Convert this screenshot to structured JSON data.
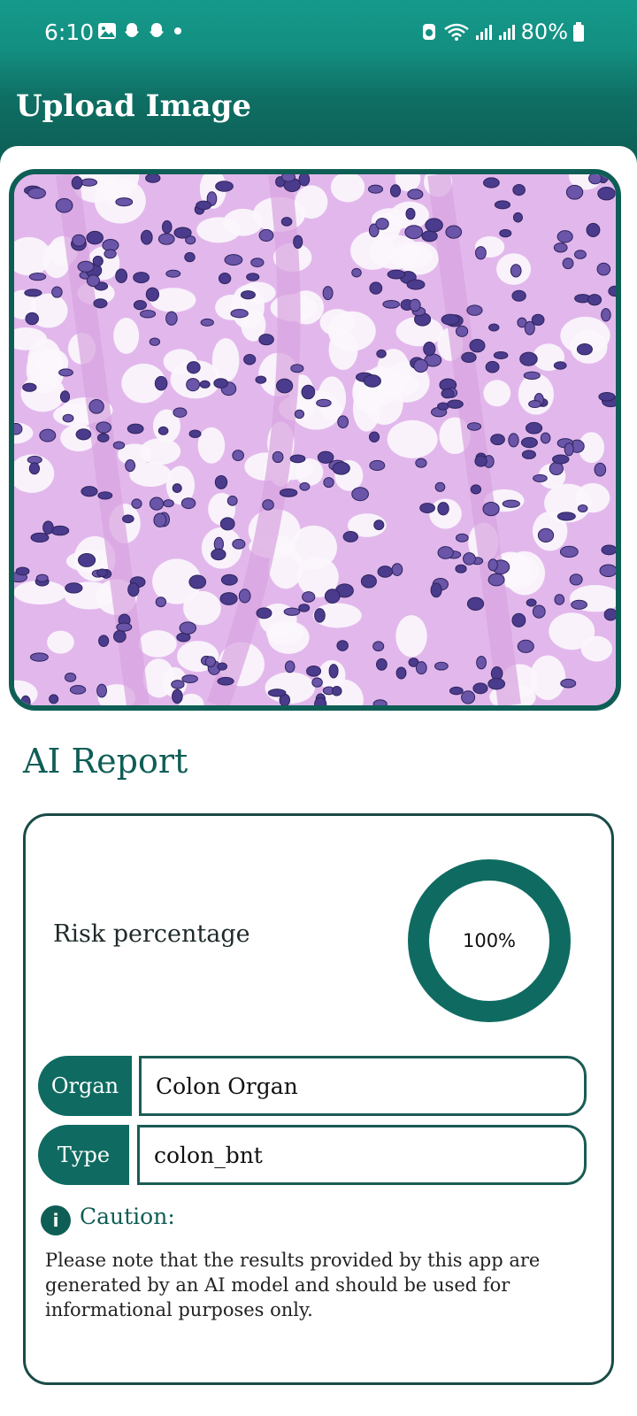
{
  "status_bar": {
    "time": "6:10",
    "battery": "80%",
    "left_icons": [
      "gallery-icon",
      "snapchat-icon",
      "snapchat-icon",
      "dot-icon"
    ],
    "right_icons": [
      "data-saver-icon",
      "wifi-icon",
      "signal-icon",
      "signal-icon",
      "battery-icon"
    ]
  },
  "header": {
    "title": "Upload Image"
  },
  "image": {
    "alt": "Histology tissue image"
  },
  "report": {
    "title": "AI Report",
    "risk_label": "Risk percentage",
    "risk_text": "100%",
    "risk_fraction": 1.0,
    "organ_label": "Organ",
    "organ_value": "Colon Organ",
    "type_label": "Type",
    "type_value": "colon_bnt",
    "caution_title": "Caution:",
    "caution_text": "Please note that the results provided by this app are generated by an AI model and should be used for informational purposes only."
  },
  "colors": {
    "primary": "#0f6b61",
    "header": "#149a8b"
  }
}
